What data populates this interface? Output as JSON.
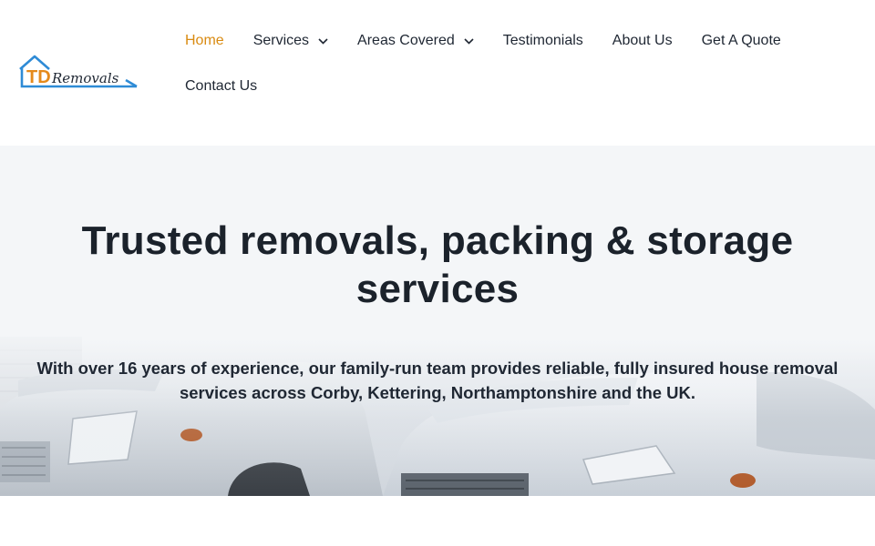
{
  "brand": {
    "logo_text_td": "TD",
    "logo_text_rest": "Removals",
    "colors": {
      "td": "#e58a1c",
      "roof": "#2e8bd6",
      "script": "#1f2733"
    }
  },
  "nav": {
    "items": [
      {
        "label": "Home",
        "active": true
      },
      {
        "label": "Services",
        "has_dropdown": true
      },
      {
        "label": "Areas Covered",
        "has_dropdown": true
      },
      {
        "label": "Testimonials"
      },
      {
        "label": "About Us"
      },
      {
        "label": "Get A Quote"
      },
      {
        "label": "Contact Us"
      }
    ],
    "active_color": "#d98b12"
  },
  "hero": {
    "title": "Trusted removals, packing & storage services",
    "subtitle": "With over 16 years of experience, our family-run team provides reliable, fully insured house removal services across Corby, Kettering, Northamptonshire and the UK."
  }
}
